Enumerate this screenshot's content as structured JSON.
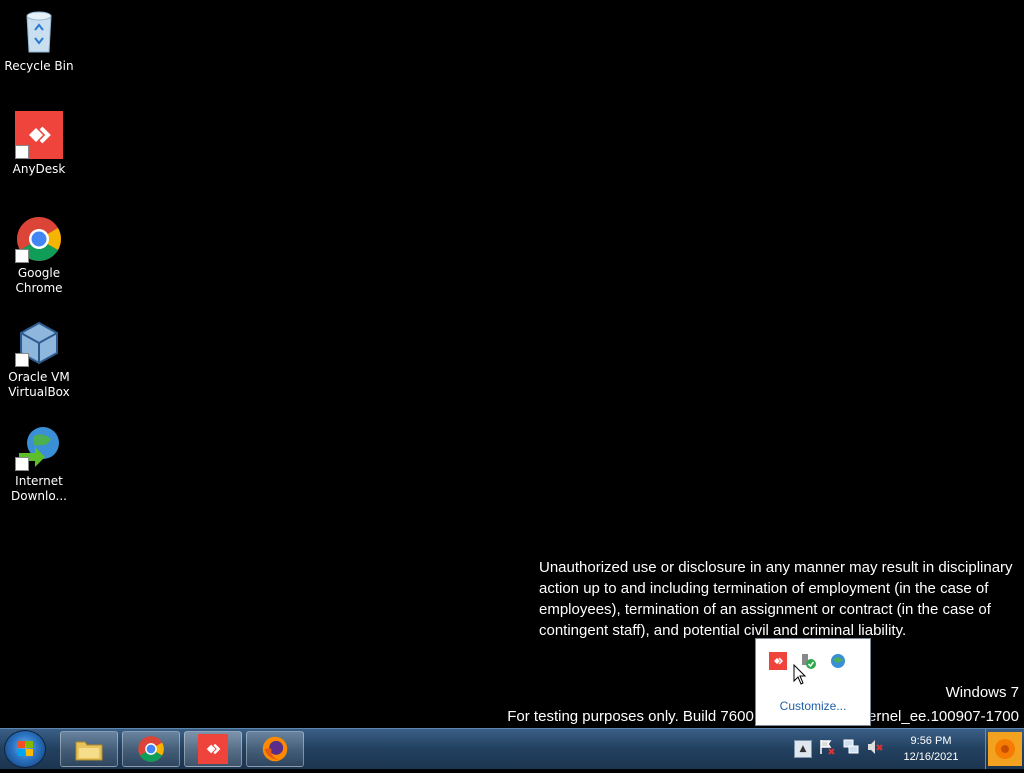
{
  "desktop": {
    "icons": [
      {
        "label": "Recycle Bin",
        "icon": "recycle-bin-icon"
      },
      {
        "label": "AnyDesk",
        "icon": "anydesk-icon"
      },
      {
        "label": "Google Chrome",
        "icon": "chrome-icon"
      },
      {
        "label": "Oracle VM VirtualBox",
        "icon": "virtualbox-icon"
      },
      {
        "label": "Internet Downlo...",
        "icon": "internet-download-manager-icon"
      }
    ]
  },
  "notice": {
    "text": "Unauthorized use or disclosure in any manner may result in disciplinary action up to and including termination of employment (in the case of employees), termination of an assignment or contract (in the case of contingent staff), and potential civil and criminal liability."
  },
  "watermark": {
    "os": "Windows 7",
    "build": "For testing purposes only. Build 7600.winmain_win7internel_ee.100907-1700"
  },
  "tray_popup": {
    "icons": [
      "anydesk-tray-icon",
      "safely-remove-hardware-icon",
      "network-globe-icon"
    ],
    "customize_label": "Customize..."
  },
  "taskbar": {
    "pinned": [
      "file-explorer-icon",
      "chrome-icon",
      "anydesk-icon",
      "firefox-icon"
    ],
    "tray_icons": [
      "show-hidden-icons",
      "action-center-flag-icon",
      "network-icon",
      "volume-muted-icon"
    ],
    "time": "9:56 PM",
    "date": "12/16/2021"
  },
  "colors": {
    "anydesk_red": "#ef443b",
    "taskbar": "#22405f",
    "link_blue": "#1f5fa8"
  }
}
